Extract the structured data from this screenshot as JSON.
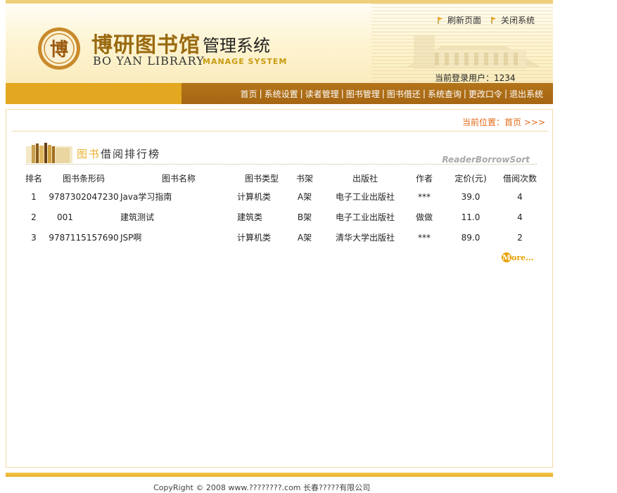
{
  "header": {
    "logo_text": "博",
    "title_cn": "博研图书馆",
    "title_sub": "管理系统",
    "title_en": "BO YAN LIBRARY",
    "title_en_sub": "MANAGE SYSTEM",
    "links": [
      {
        "label": "刷新页面"
      },
      {
        "label": "关闭系统"
      }
    ],
    "login_user_label": "当前登录用户：",
    "login_user": "1234"
  },
  "nav": {
    "items": [
      "首页",
      "系统设置",
      "读者管理",
      "图书管理",
      "图书借还",
      "系统查询",
      "更改口令",
      "退出系统"
    ],
    "separator": "|"
  },
  "breadcrumb": {
    "label": "当前位置：",
    "current": "首页",
    "arrows": ">>>"
  },
  "section": {
    "title_highlight": "图书",
    "title_rest": "借阅排行榜",
    "title_en": "ReaderBorrowSort"
  },
  "table": {
    "columns": [
      "排名",
      "图书条形码",
      "图书名称",
      "图书类型",
      "书架",
      "出版社",
      "作者",
      "定价(元)",
      "借阅次数"
    ],
    "rows": [
      [
        "1",
        "9787302047230",
        "Java学习指南",
        "计算机类",
        "A架",
        "电子工业出版社",
        "***",
        "39.0",
        "4"
      ],
      [
        "2",
        "001",
        "建筑测试",
        "建筑类",
        "B架",
        "电子工业出版社",
        "做做",
        "11.0",
        "4"
      ],
      [
        "3",
        "9787115157690",
        "JSP啊",
        "计算机类",
        "A架",
        "清华大学出版社",
        "***",
        "89.0",
        "2"
      ]
    ]
  },
  "more": {
    "initial": "M",
    "rest": "ore..."
  },
  "footer": {
    "text": "CopyRight © 2008 www.????????.com 长春?????有限公司"
  },
  "colors": {
    "accent_orange": "#e46a18",
    "nav_brown": "#a66512",
    "nav_gold": "#e3a820"
  }
}
